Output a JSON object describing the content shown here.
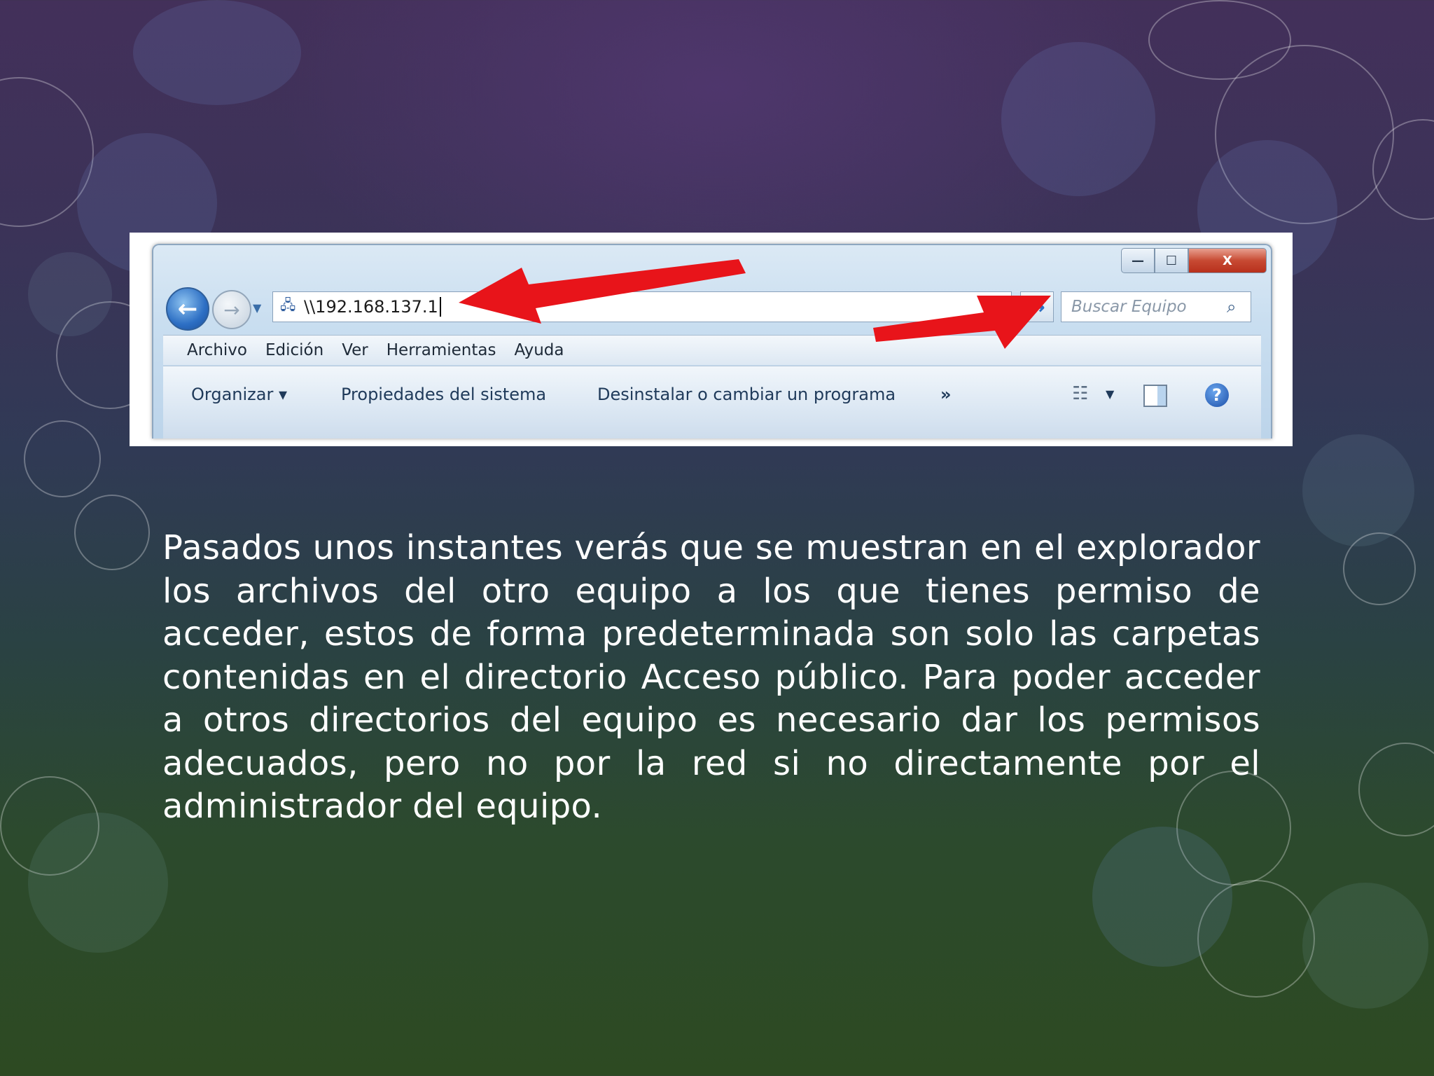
{
  "window": {
    "caption_buttons": {
      "minimize": "—",
      "maximize": "☐",
      "close": "X"
    },
    "address_bar": {
      "value": "\\\\192.168.137.1"
    },
    "search": {
      "placeholder": "Buscar Equipo"
    },
    "menu": [
      "Archivo",
      "Edición",
      "Ver",
      "Herramientas",
      "Ayuda"
    ],
    "commands": {
      "organize": "Organizar ▾",
      "system_properties": "Propiedades del sistema",
      "uninstall": "Desinstalar o cambiar un programa",
      "more": "»"
    },
    "icons": {
      "back": "back-arrow-icon",
      "forward": "forward-arrow-icon",
      "go": "go-arrow-icon",
      "search": "search-icon",
      "help": "help-icon"
    },
    "annotation_color": "#e8141a"
  },
  "body_text": "Pasados unos instantes verás que se muestran en el explorador los archivos del otro equipo a los que tienes permiso de acceder, estos de forma predeterminada son solo las carpetas contenidas en el directorio Acceso público. Para poder acceder a otros directorios del equipo es necesario dar los permisos adecuados, pero no por la red si no directamente por el administrador del equipo."
}
